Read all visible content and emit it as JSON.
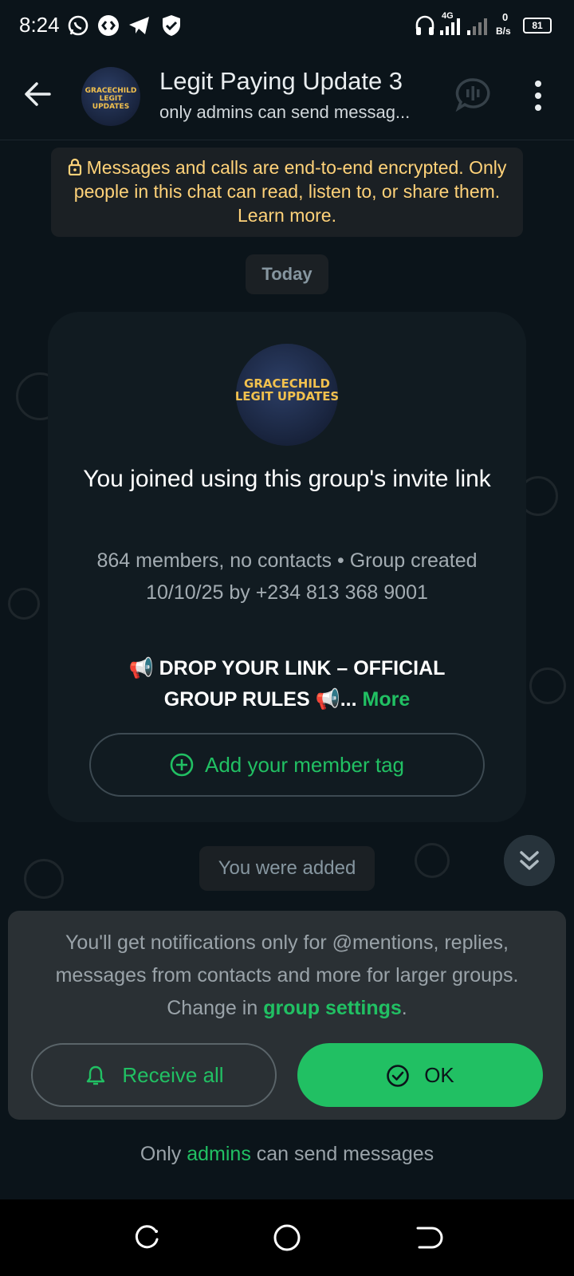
{
  "status_bar": {
    "time": "8:24",
    "network": "4G",
    "speed_value": "0",
    "speed_unit": "B/s",
    "battery": "81"
  },
  "header": {
    "title": "Legit Paying Update 3",
    "subtitle": "only admins can send messag...",
    "avatar_text_line1": "GRACECHILD",
    "avatar_text_line2": "LEGIT UPDATES"
  },
  "encryption_notice": {
    "text": "Messages and calls are end-to-end encrypted. Only people in this chat can read, listen to, or share them. Learn more."
  },
  "date_chip": "Today",
  "group_card": {
    "avatar_text_line1": "GRACECHILD",
    "avatar_text_line2": "LEGIT UPDATES",
    "title": "You joined using this group's invite link",
    "meta": "864 members, no contacts • Group created 10/10/25 by +234 813 368 9001",
    "rules_preview": "📢 DROP YOUR LINK – OFFICIAL GROUP RULES 📢...",
    "more_label": "More",
    "member_tag_button": "Add your member tag"
  },
  "system_message": "You were added",
  "notification_panel": {
    "text_before_link": "You'll get notifications only for @mentions, replies, messages from contacts and more for larger groups. Change in ",
    "link_text": "group settings",
    "text_after_link": ".",
    "receive_all_label": "Receive all",
    "ok_label": "OK"
  },
  "footer": {
    "prefix": "Only ",
    "link": "admins",
    "suffix": " can send messages"
  },
  "colors": {
    "accent_green": "#21c063",
    "background": "#0b141a",
    "encryption_yellow": "#ffd279"
  }
}
